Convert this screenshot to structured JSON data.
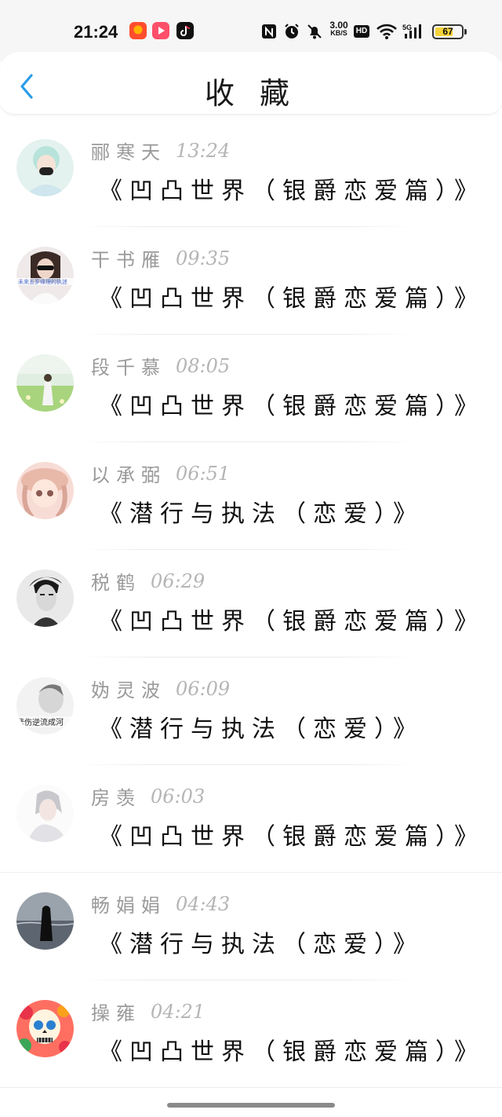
{
  "status_bar": {
    "time": "21:24",
    "net_speed_value": "3.00",
    "net_speed_unit": "KB/S",
    "hd_label": "HD",
    "network_type": "5G",
    "battery_level": "67"
  },
  "header": {
    "title": "收 藏"
  },
  "accent_color": "#2a9de8",
  "favorites": [
    {
      "name": "郦寒天",
      "time": "13:24",
      "book": "《凹凸世界（银爵恋爱篇）》",
      "avatar": "avatar-masked-boy"
    },
    {
      "name": "干书雁",
      "time": "09:35",
      "book": "《凹凸世界（银爵恋爱篇）》",
      "avatar": "avatar-girl-sunglasses"
    },
    {
      "name": "段千慕",
      "time": "08:05",
      "book": "《凹凸世界（银爵恋爱篇）》",
      "avatar": "avatar-girl-field"
    },
    {
      "name": "以承弼",
      "time": "06:51",
      "book": "《潜行与执法（恋爱）》",
      "avatar": "avatar-anime-girl"
    },
    {
      "name": "税鹤",
      "time": "06:29",
      "book": "《凹凸世界（银爵恋爱篇）》",
      "avatar": "avatar-man-bw"
    },
    {
      "name": "妫灵波",
      "time": "06:09",
      "book": "《潜行与执法（恋爱）》",
      "avatar": "avatar-sad-text"
    },
    {
      "name": "房羡",
      "time": "06:03",
      "book": "《凹凸世界（银爵恋爱篇）》",
      "avatar": "avatar-anime-boy"
    },
    {
      "name": "畅娟娟",
      "time": "04:43",
      "book": "《潜行与执法（恋爱）》",
      "avatar": "avatar-sea-girl"
    },
    {
      "name": "操雍",
      "time": "04:21",
      "book": "《凹凸世界（银爵恋爱篇）》",
      "avatar": "avatar-sugar-skull"
    }
  ]
}
